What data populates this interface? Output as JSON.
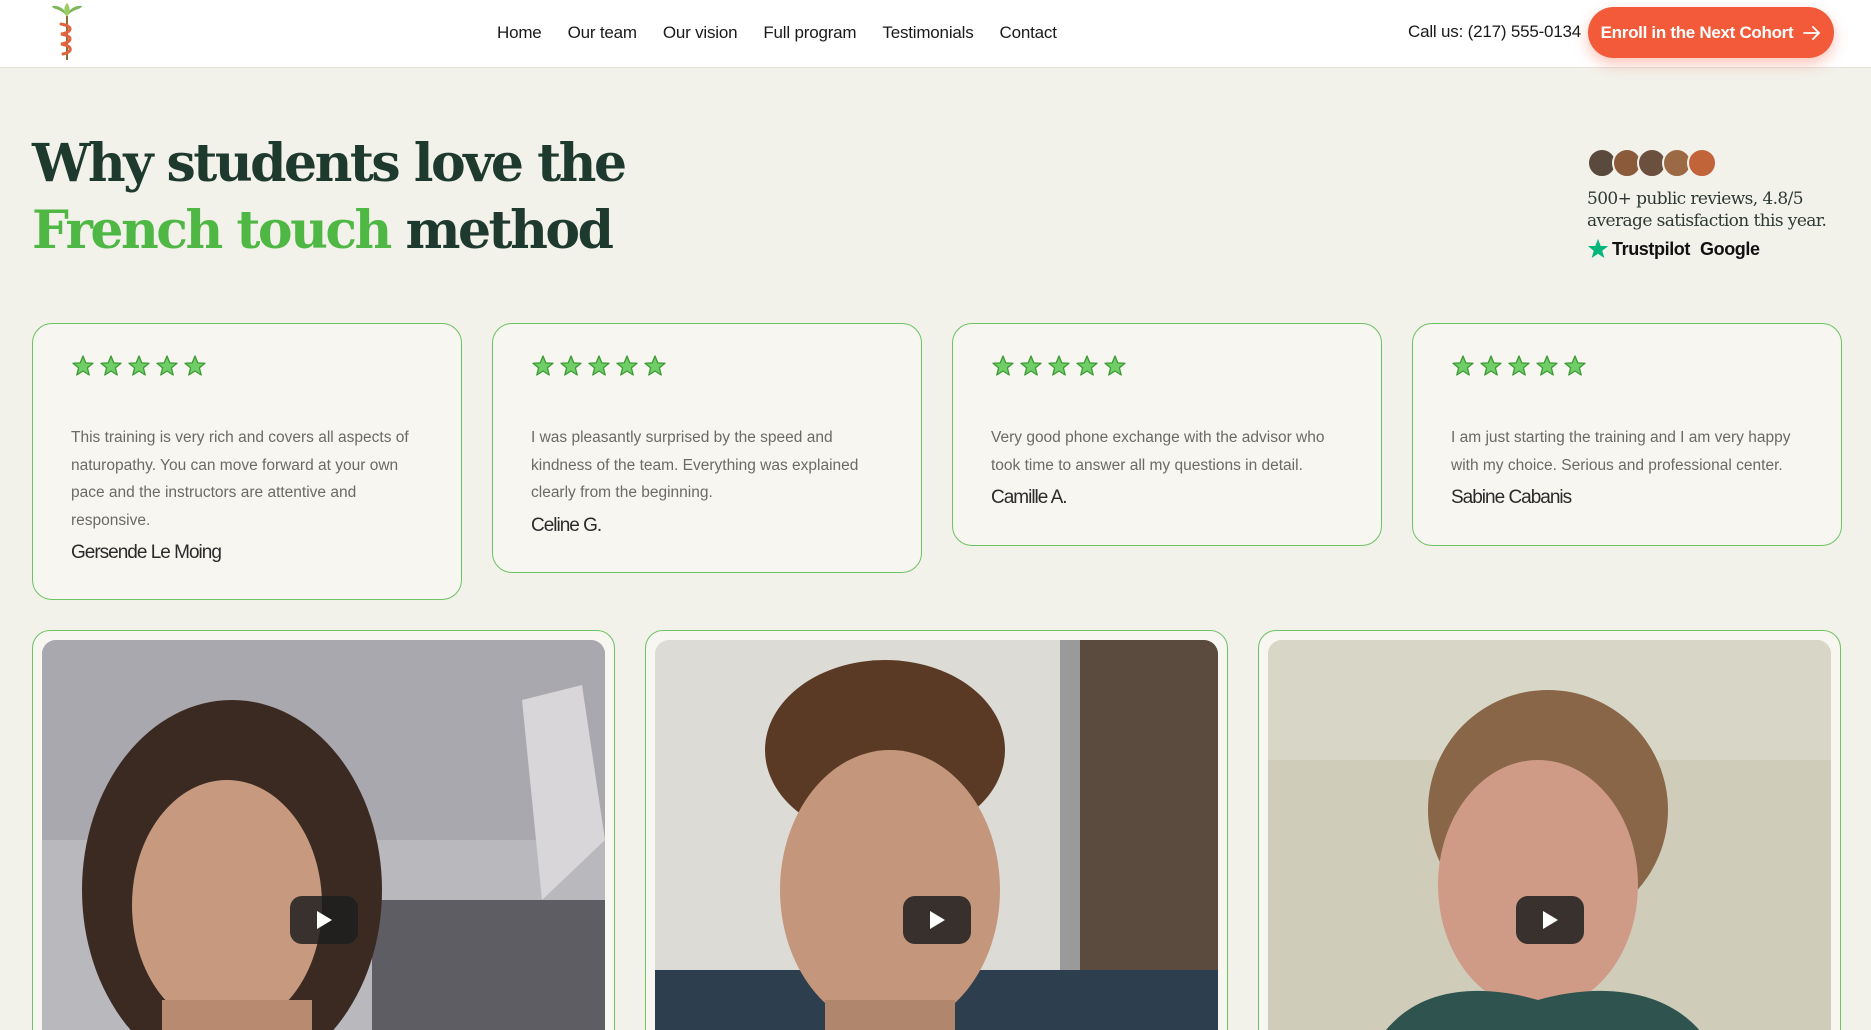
{
  "nav": {
    "items": [
      "Home",
      "Our team",
      "Our vision",
      "Full program",
      "Testimonials",
      "Contact"
    ],
    "phone": "Call us: (217) 555-0134",
    "cta_label": "Enroll in the Next Cohort"
  },
  "hero": {
    "title_line1": "Why students love the",
    "title_highlight": "French touch",
    "title_rest": " method"
  },
  "summary": {
    "text": "500+ public reviews, 4.8/5 average satisfaction this year.",
    "trustpilot": "Trustpilot",
    "google": "Google"
  },
  "reviews": [
    {
      "rating": 5,
      "text": "This training is very rich and covers all aspects of naturopathy. You can move forward at your own pace and the instructors are attentive and responsive.",
      "author": "Gersende Le Moing"
    },
    {
      "rating": 5,
      "text": "I was pleasantly surprised by the speed and kindness of the team. Everything was explained clearly from the beginning.",
      "author": "Celine G."
    },
    {
      "rating": 5,
      "text": "Very good phone exchange with the advisor who took time to answer all my questions in detail.",
      "author": "Camille A."
    },
    {
      "rating": 5,
      "text": "I am just starting the training and I am very happy with my choice. Serious and professional center.",
      "author": "Sabine Cabanis"
    }
  ],
  "colors": {
    "accent_green": "#4fb845",
    "cta_orange": "#f25a3a",
    "background": "#f2f1ea",
    "heading_dark": "#1e3a2f",
    "star_green": "#5cc457"
  },
  "icons": [
    "logo-caduceus-icon",
    "arrow-right-icon",
    "star-icon",
    "trustpilot-star-icon",
    "play-icon"
  ]
}
